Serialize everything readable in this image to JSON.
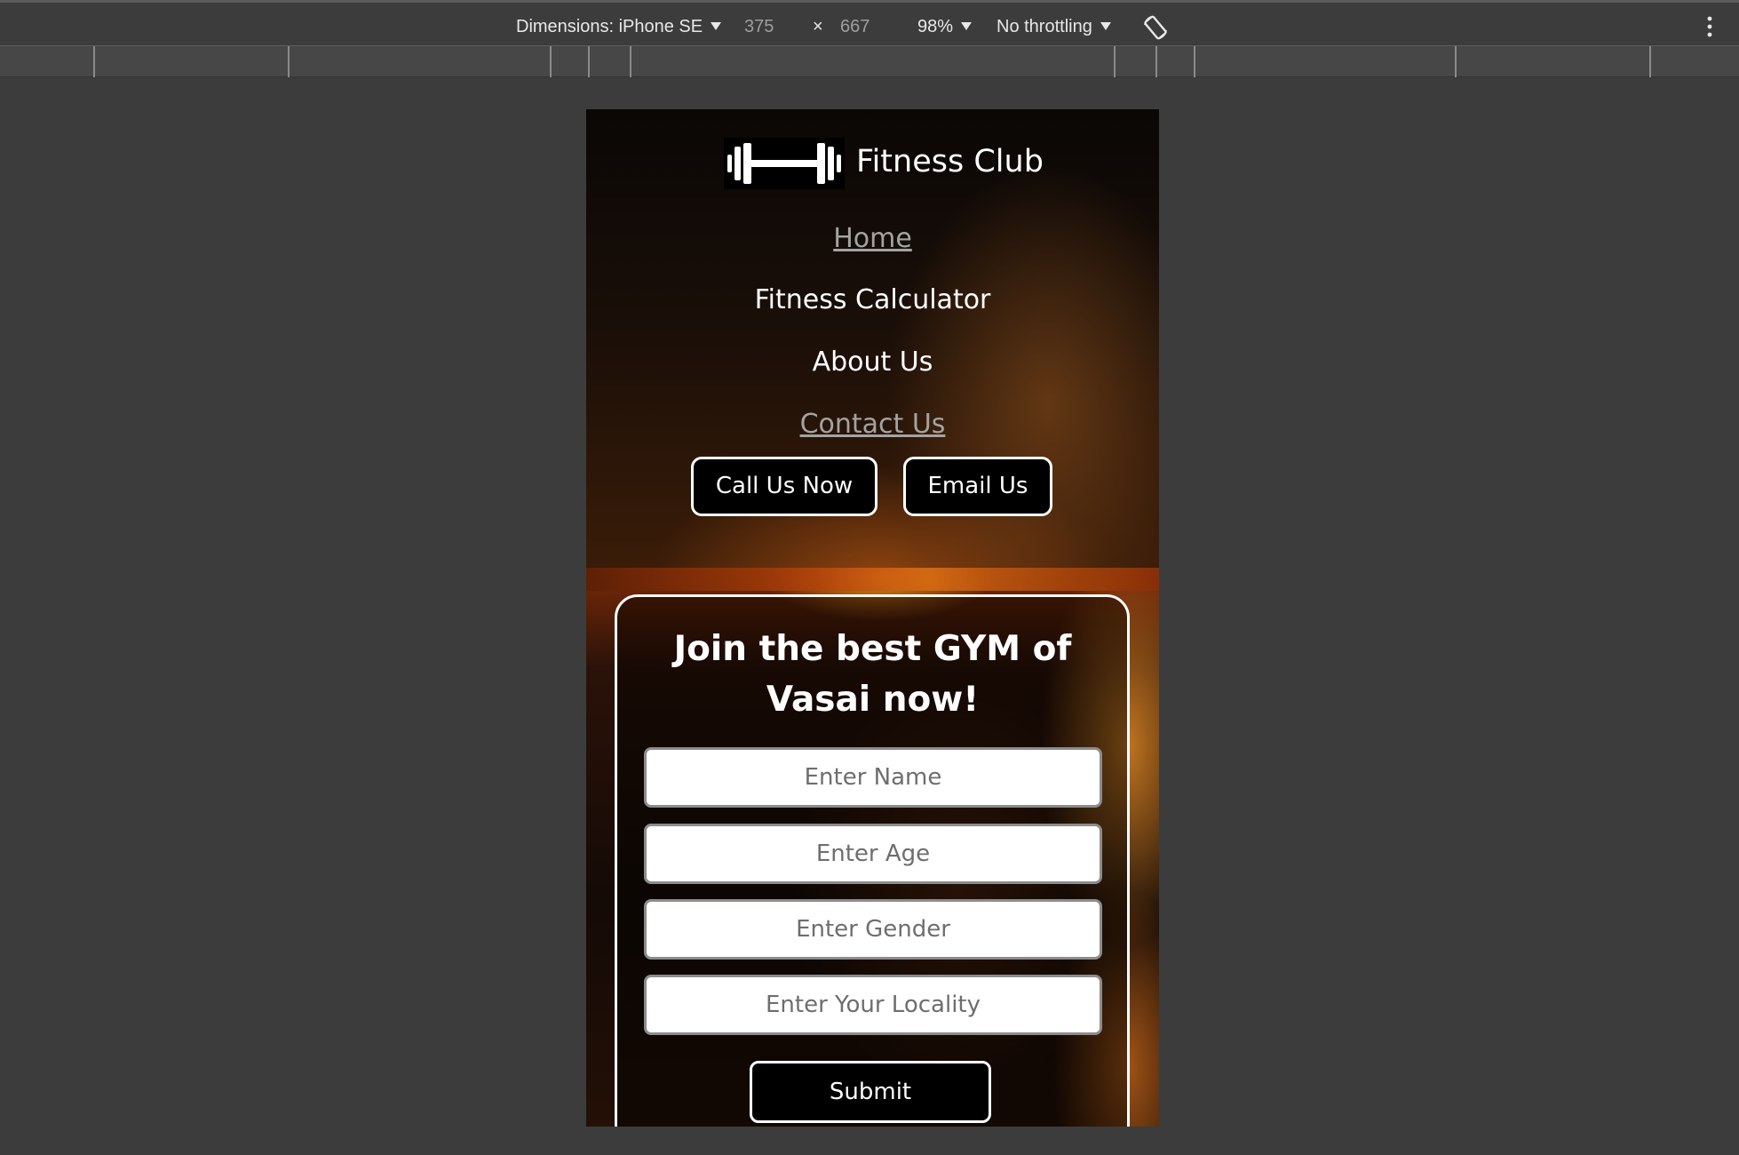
{
  "devtools": {
    "device_label": "Dimensions: iPhone SE",
    "width": "375",
    "times": "×",
    "height": "667",
    "zoom": "98%",
    "throttling": "No throttling",
    "icons": [
      "chevron-down-icon",
      "rotate-icon",
      "more-options-icon"
    ]
  },
  "site": {
    "brand": "Fitness Club",
    "logo_icon": "dumbbell-icon",
    "nav": {
      "home": "Home",
      "calculator": "Fitness Calculator",
      "about": "About Us",
      "contact": "Contact Us"
    },
    "buttons": {
      "call": "Call Us Now",
      "email": "Email Us"
    },
    "join": {
      "title_line1": "Join the best GYM of",
      "title_line2": "Vasai now!",
      "name_placeholder": "Enter Name",
      "age_placeholder": "Enter Age",
      "gender_placeholder": "Enter Gender",
      "locality_placeholder": "Enter Your Locality",
      "submit": "Submit"
    }
  },
  "colors": {
    "devtools_bg": "#3c3c3c",
    "visited_link": "#a3a3a3",
    "page_text": "#ffffff",
    "button_bg": "#000000"
  }
}
